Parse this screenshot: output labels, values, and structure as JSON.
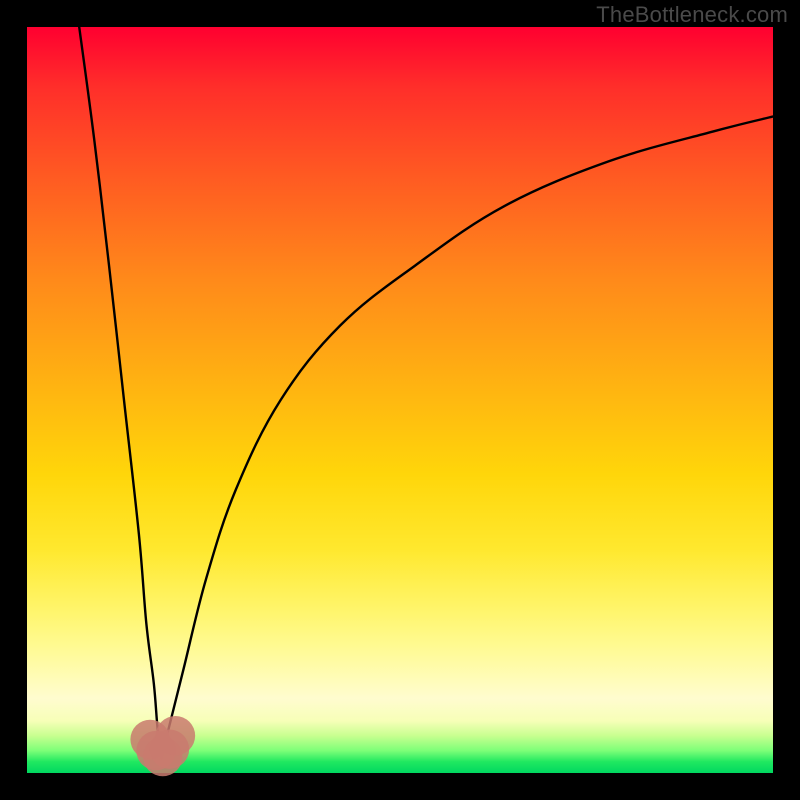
{
  "watermark": "TheBottleneck.com",
  "colors": {
    "frame": "#000000",
    "curve": "#000000",
    "marker": "#c97a6f"
  },
  "chart_data": {
    "type": "line",
    "title": "",
    "xlabel": "",
    "ylabel": "",
    "xlim": [
      0,
      100
    ],
    "ylim": [
      0,
      100
    ],
    "note": "Axes are unlabeled; values are estimated from pixel positions on a 0–100 normalized grid. The curve is a bottleneck-style V: a steep descending left branch meeting a shallower ascending right branch near x≈18, y≈2. Background gradient runs red (top, y≈100) → green (bottom, y≈0).",
    "series": [
      {
        "name": "left-branch",
        "x": [
          7,
          9,
          11,
          13,
          15,
          16,
          17,
          17.5,
          18
        ],
        "y": [
          100,
          85,
          68,
          50,
          32,
          20,
          12,
          6,
          2
        ]
      },
      {
        "name": "right-branch",
        "x": [
          18,
          19,
          21,
          24,
          28,
          34,
          42,
          52,
          64,
          78,
          92,
          100
        ],
        "y": [
          2,
          6,
          14,
          26,
          38,
          50,
          60,
          68,
          76,
          82,
          86,
          88
        ]
      }
    ],
    "markers": {
      "name": "bottleneck-points",
      "note": "Cluster of soft salmon dots at the trough of the V.",
      "points": [
        {
          "x": 16.5,
          "y": 4.5,
          "r": 2.2
        },
        {
          "x": 17.3,
          "y": 3.0,
          "r": 2.2
        },
        {
          "x": 18.2,
          "y": 2.2,
          "r": 2.2
        },
        {
          "x": 19.1,
          "y": 3.2,
          "r": 2.2
        },
        {
          "x": 19.9,
          "y": 5.0,
          "r": 2.2
        }
      ]
    },
    "background_gradient": {
      "direction": "vertical",
      "stops": [
        {
          "y": 100,
          "color": "#ff0030"
        },
        {
          "y": 50,
          "color": "#ffb311"
        },
        {
          "y": 20,
          "color": "#fff56a"
        },
        {
          "y": 5,
          "color": "#c8ff90"
        },
        {
          "y": 0,
          "color": "#00d860"
        }
      ]
    }
  }
}
